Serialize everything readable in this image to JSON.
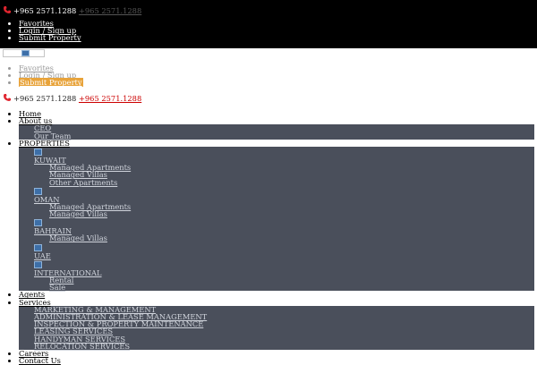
{
  "topbar": {
    "phone_primary": "+965 2571.1288",
    "phone_link": "+965 2571.1288",
    "links": [
      "Favorites",
      "Login / Sign up",
      "Submit Property"
    ]
  },
  "mobile_menu": {
    "links": [
      "Favorites",
      "Login / Sign up",
      "Submit Property"
    ],
    "phone_primary": "+965 2571.1288",
    "phone_link": "+965 2571.1288"
  },
  "nav": {
    "home": "Home",
    "about": "About us",
    "about_sub": [
      "CEO",
      "Our Team"
    ],
    "properties": "PROPERTIES",
    "kuwait": "KUWAIT",
    "kuwait_sub": [
      "Managed Apartments",
      "Managed Villas",
      "Other Apartments"
    ],
    "oman": "OMAN",
    "oman_sub": [
      "Managed Apartments",
      "Managed Villas"
    ],
    "bahrain": "BAHRAIN",
    "bahrain_sub": [
      "Managed Villas"
    ],
    "uae": "UAE",
    "international": "INTERNATIONAL",
    "international_sub": [
      "Rental",
      "Sale"
    ],
    "agents": "Agents",
    "services": "Services",
    "services_sub": [
      "MARKETING & MANAGEMENT",
      "ADMINISTRATION & LEASE MANAGEMENT",
      "INSPECTION & PROPERTY MAINTENANCE",
      "LEASING SERVICES",
      "HANDYMAN SERVICES",
      "RELOCATION SERVICES"
    ],
    "careers": "Careers",
    "contact": "Contact Us"
  },
  "colors": {
    "topbar_bg": "#000000",
    "submenu_bg": "#4a4f5b",
    "phone_icon": "#e0252f",
    "highlight": "#e8a33a"
  },
  "icons": [
    "phone-icon",
    "broken-image-icon"
  ]
}
